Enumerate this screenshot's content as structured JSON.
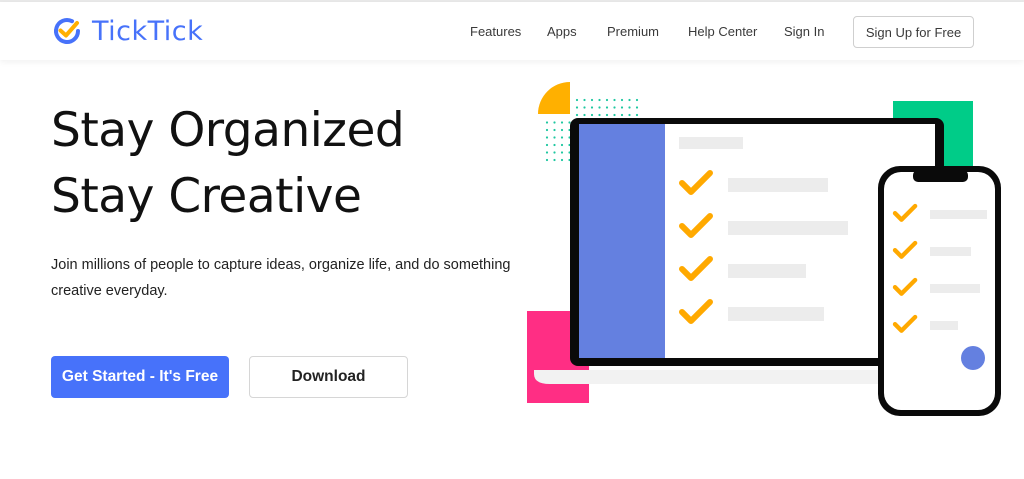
{
  "brand": {
    "name": "TickTick",
    "accent": "#4772fa",
    "logo_check_color": "#ffb000"
  },
  "nav": {
    "items": [
      {
        "label": "Features"
      },
      {
        "label": "Apps"
      },
      {
        "label": "Premium"
      },
      {
        "label": "Help Center"
      },
      {
        "label": "Sign In"
      }
    ],
    "signup_label": "Sign Up for Free"
  },
  "hero": {
    "title_line1": "Stay Organized",
    "title_line2": "Stay Creative",
    "subtitle": "Join millions of people to capture ideas, organize life, and do something creative everyday.",
    "primary_button": "Get Started - It's Free",
    "secondary_button": "Download"
  },
  "illustration": {
    "colors": {
      "sidebar": "#6480e0",
      "check": "#ffa900",
      "pink": "#ff2e84",
      "green": "#00cc88",
      "yellow": "#ffb000",
      "dots": "#1ec7a0",
      "bar": "#ececec",
      "frame": "#0a0a0a",
      "phone_dot": "#6480e0"
    },
    "laptop_task_count": 4,
    "phone_task_count": 4
  }
}
